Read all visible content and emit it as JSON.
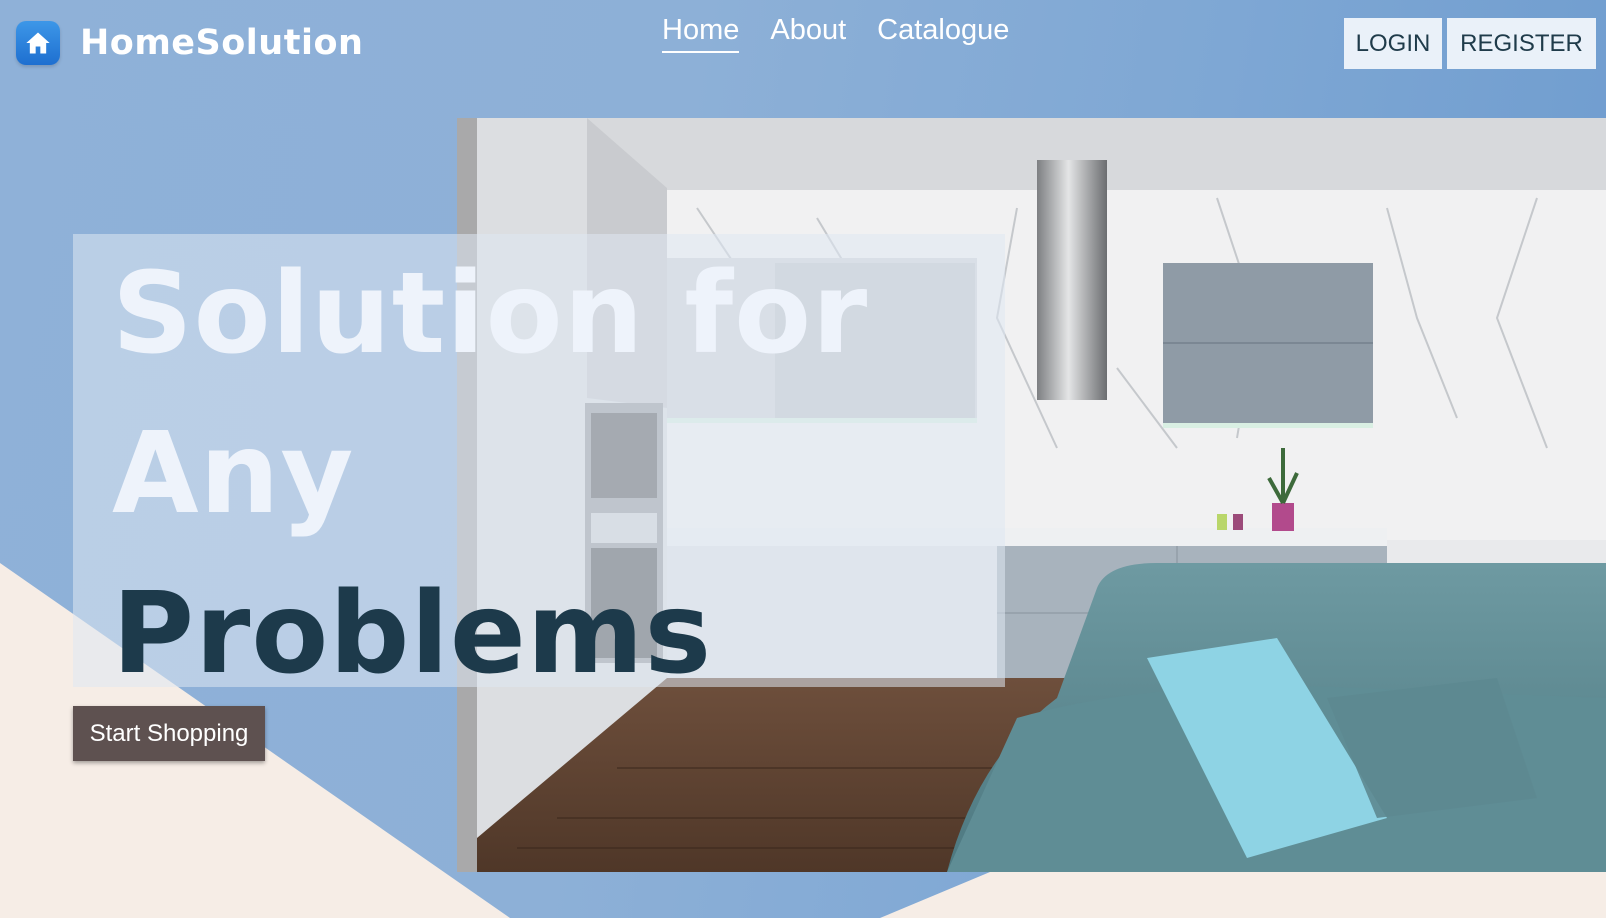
{
  "header": {
    "brand": "HomeSolution",
    "logo_icon": "home-icon",
    "nav": [
      {
        "label": "Home",
        "active": true
      },
      {
        "label": "About",
        "active": false
      },
      {
        "label": "Catalogue",
        "active": false
      }
    ],
    "login_label": "LOGIN",
    "register_label": "REGISTER"
  },
  "hero": {
    "headline_line1": "Solution for",
    "headline_line2": "Any",
    "headline_line3": "Problems",
    "cta_label": "Start Shopping",
    "image_subject": "kitchen-living-room-photo"
  },
  "colors": {
    "background_blue": "#8db0d7",
    "cream_shape": "#f6ede6",
    "headline_light": "#eef3fb",
    "headline_dark": "#1d3a4b",
    "cta_bg": "#5e5150",
    "auth_btn_bg": "#eaf1f9",
    "logo_bg": "#1e6fd0"
  }
}
